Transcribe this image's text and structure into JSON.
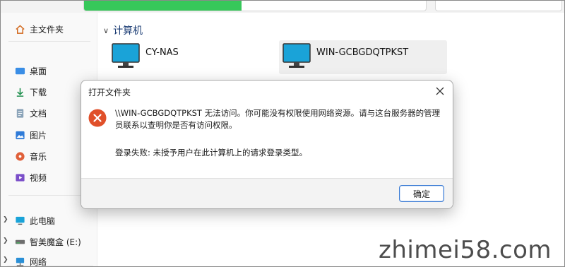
{
  "sidebar": {
    "items": [
      {
        "label": "主文件夹",
        "icon": "home-icon"
      },
      {
        "label": "桌面",
        "icon": "desktop-icon"
      },
      {
        "label": "下载",
        "icon": "download-icon"
      },
      {
        "label": "文档",
        "icon": "document-icon"
      },
      {
        "label": "图片",
        "icon": "pictures-icon"
      },
      {
        "label": "音乐",
        "icon": "music-icon"
      },
      {
        "label": "视频",
        "icon": "video-icon"
      },
      {
        "label": "此电脑",
        "icon": "this-pc-icon"
      },
      {
        "label": "智美魔盒 (E:)",
        "icon": "drive-icon"
      },
      {
        "label": "网络",
        "icon": "network-icon"
      }
    ]
  },
  "main": {
    "section_title": "计算机",
    "computers": [
      {
        "name": "CY-NAS"
      },
      {
        "name": "WIN-GCBGDQTPKST"
      }
    ]
  },
  "dialog": {
    "title": "打开文件夹",
    "message_line1": "\\\\WIN-GCBGDQTPKST 无法访问。你可能没有权限使用网络资源。请与这台服务器的管理员联系以查明你是否有访问权限。",
    "message_line2": "登录失败: 未授予用户在此计算机上的请求登录类型。",
    "ok_label": "确定"
  },
  "address_bar": {
    "progress_fraction": 0.46
  },
  "watermark": "zhimei58.com",
  "colors": {
    "accent": "#3b7bd4",
    "progress": "#37c85a",
    "error": "#e0502a",
    "monitor": "#1aa3d8"
  }
}
